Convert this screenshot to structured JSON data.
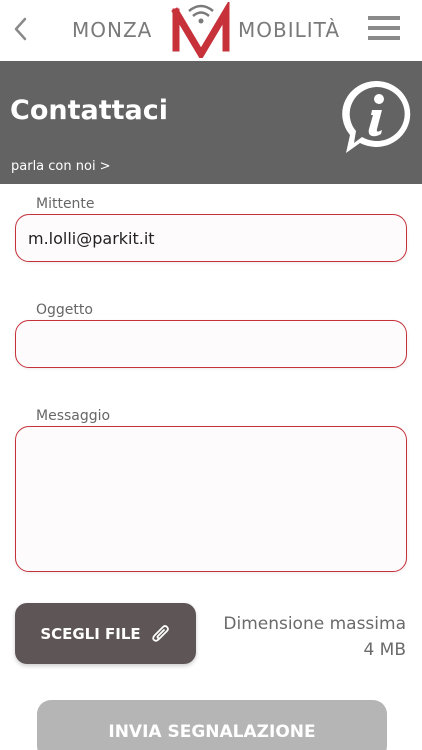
{
  "app": {
    "logo_left": "MONZA",
    "logo_right": "MOBILITÀ",
    "brand_red": "#c6313a",
    "back_icon": "chevron-left-icon",
    "menu_icon": "hamburger-menu-icon"
  },
  "header": {
    "title": "Contattaci",
    "subtitle": "parla con noi >",
    "icon": "info-icon",
    "background": "#636363"
  },
  "form": {
    "sender_label": "Mittente",
    "sender_value": "m.lolli@parkit.it",
    "subject_label": "Oggetto",
    "subject_value": "",
    "message_label": "Messaggio",
    "message_value": ""
  },
  "attachment": {
    "button_label": "SCEGLI FILE",
    "button_icon": "paperclip-icon",
    "max_size_label": "Dimensione massima",
    "max_size_value": "4 MB"
  },
  "submit": {
    "label": "INVIA SEGNALAZIONE"
  }
}
